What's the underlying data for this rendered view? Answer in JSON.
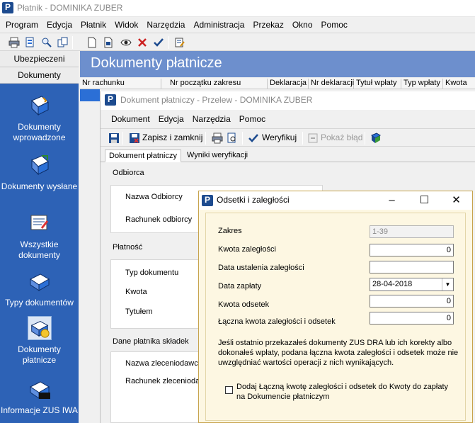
{
  "app": {
    "title": "Płatnik - DOMINIKA ZUBER",
    "menu": [
      "Program",
      "Edycja",
      "Płatnik",
      "Widok",
      "Narzędzia",
      "Administracja",
      "Przekaz",
      "Okno",
      "Pomoc"
    ]
  },
  "nav": {
    "tabs": [
      "Ubezpieczeni",
      "Dokumenty"
    ],
    "items": [
      {
        "label": "Dokumenty wprowadzone",
        "icon": "document-in-icon"
      },
      {
        "label": "Dokumenty wysłane",
        "icon": "document-sent-icon"
      },
      {
        "label": "Wszystkie dokumenty",
        "icon": "all-documents-icon"
      },
      {
        "label": "Typy dokumentów",
        "icon": "document-types-icon"
      },
      {
        "label": "Dokumenty płatnicze",
        "icon": "payment-documents-icon"
      },
      {
        "label": "Informacje ZUS IWA",
        "icon": "zus-iwa-icon"
      }
    ]
  },
  "main": {
    "heading": "Dokumenty płatnicze",
    "columns": [
      "Nr rachunku",
      "Nr początku zakresu",
      "Deklaracja",
      "Nr deklaracji",
      "Tytuł wpłaty",
      "Typ wpłaty",
      "Kwota"
    ]
  },
  "doc_window": {
    "title": "Dokument płatniczy - Przelew - DOMINIKA ZUBER",
    "menu": [
      "Dokument",
      "Edycja",
      "Narzędzia",
      "Pomoc"
    ],
    "toolbar": {
      "save_close": "Zapisz i zamknij",
      "verify": "Weryfikuj",
      "show_error": "Pokaż błąd"
    },
    "tabs": [
      "Dokument płatniczy",
      "Wyniki weryfikacji"
    ],
    "sections": {
      "recipient": {
        "title": "Odbiorca",
        "fields": [
          "Nazwa Odbiorcy",
          "Rachunek odbiorcy"
        ]
      },
      "payment": {
        "title": "Płatność",
        "fields": [
          "Typ dokumentu",
          "Kwota",
          "Tytułem"
        ]
      },
      "payer": {
        "title": "Dane płatnika składek",
        "fields": [
          "Nazwa zleceniodawcy",
          "Rachunek zleceniodawcy"
        ]
      }
    }
  },
  "dialog": {
    "title": "Odsetki i zaległości",
    "fields": {
      "range": {
        "label": "Zakres",
        "value": "1-39"
      },
      "arrears_amount": {
        "label": "Kwota zaległości",
        "value": "0"
      },
      "arrears_date": {
        "label": "Data ustalenia zaległości",
        "value": ""
      },
      "payment_date": {
        "label": "Data zapłaty",
        "value": "28-04-2018"
      },
      "interest_amount": {
        "label": "Kwota odsetek",
        "value": "0"
      },
      "total_amount": {
        "label": "Łączna kwota zaległości i odsetek",
        "value": "0"
      }
    },
    "info": "Jeśli ostatnio przekazałeś dokumenty ZUS DRA lub ich korekty albo dokonałeś wpłaty, podana łączna kwota zaległości i odsetek może nie uwzględniać wartości operacji z nich wynikających.",
    "checkbox_label": "Dodaj Łączną kwotę zaległości i odsetek do Kwoty do zapłaty na Dokumencie płatniczym",
    "checkbox_checked": false
  }
}
